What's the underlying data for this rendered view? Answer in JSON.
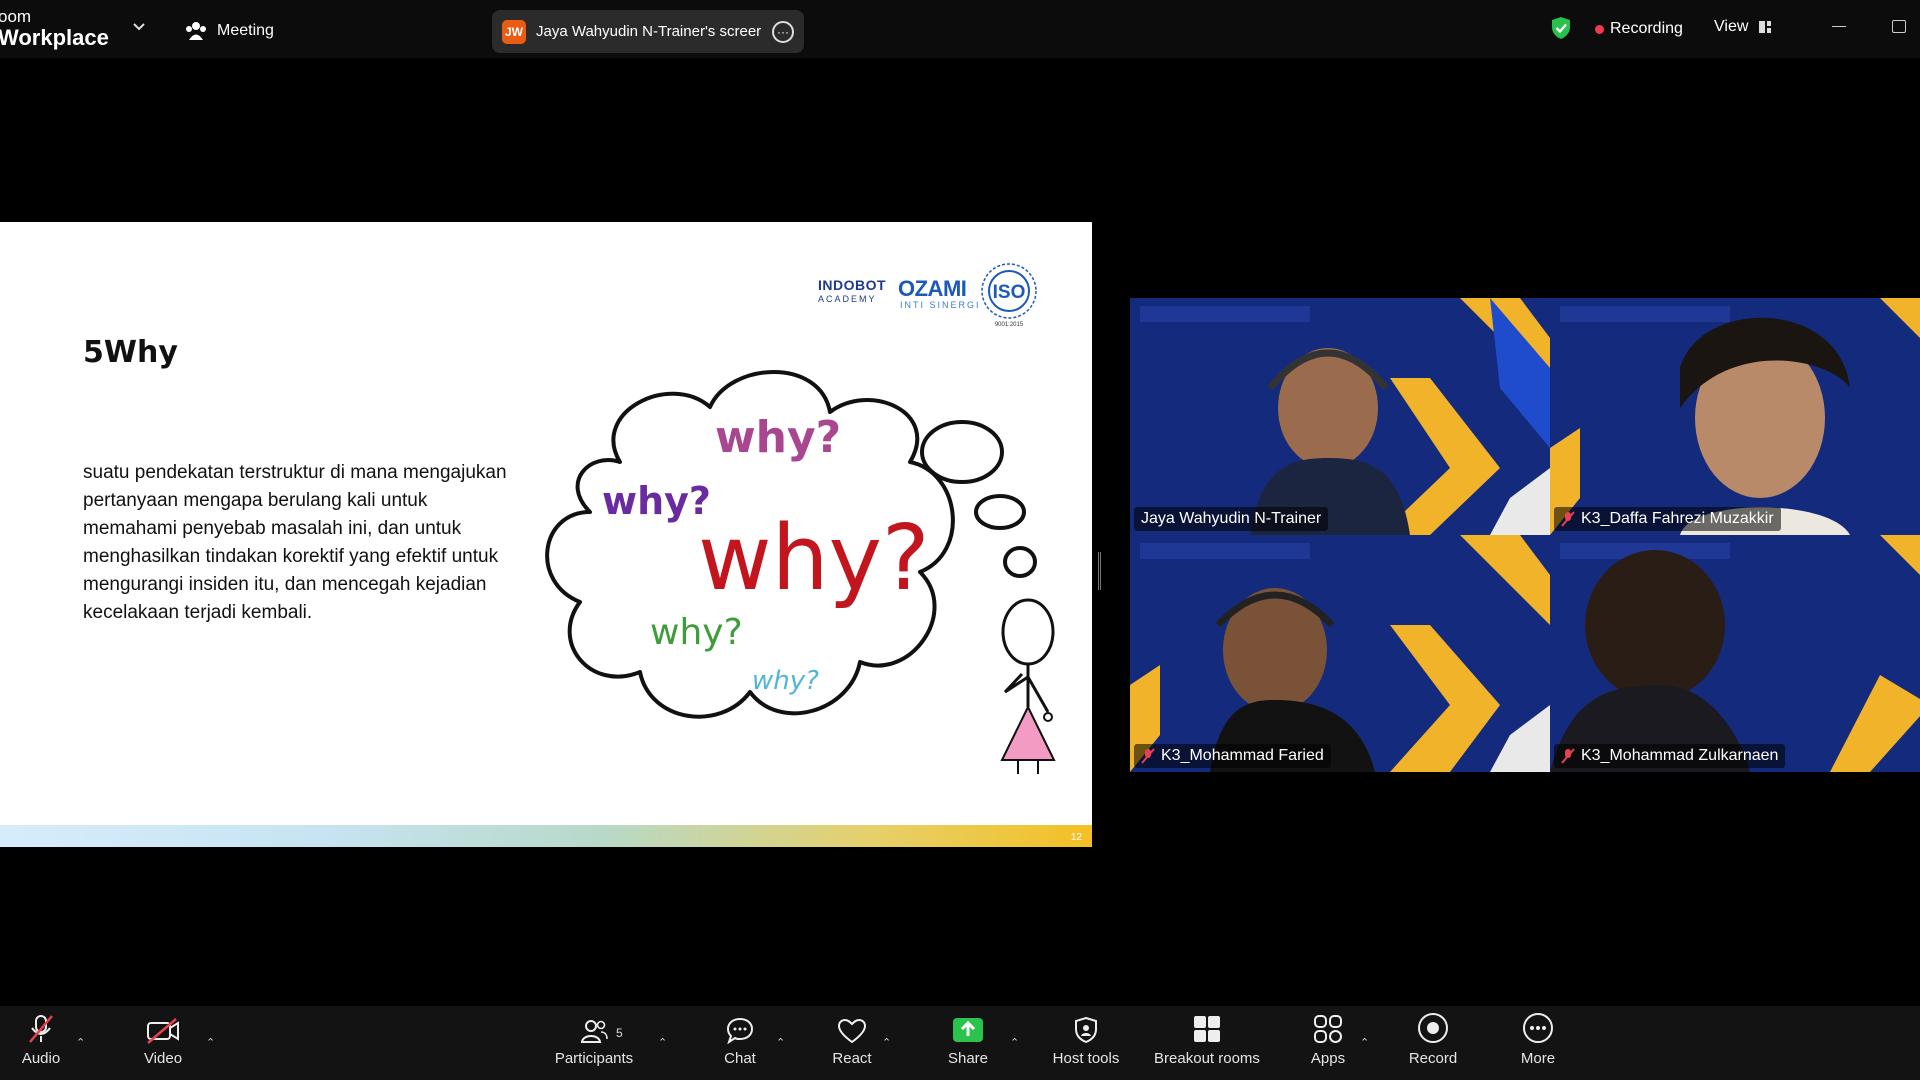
{
  "topbar": {
    "brand_line1": "oom",
    "brand_line2": "Workplace",
    "meeting_label": "Meeting",
    "sharer_initials": "JW",
    "sharer_label": "Jaya Wahyudin N-Trainer's screer",
    "recording_label": "Recording",
    "view_label": "View"
  },
  "slide": {
    "title": "5Why",
    "body": "suatu pendekatan terstruktur di mana mengajukan pertanyaan mengapa berulang kali untuk memahami penyebab masalah ini, dan untuk menghasilkan tindakan korektif yang efektif untuk mengurangi insiden itu, dan mencegah kejadian kecelakaan terjadi kembali.",
    "logo_indobot": "INDOBOT",
    "logo_academy": "ACADEMY",
    "logo_ozami": "OZAMI",
    "logo_inti": "INTI SINERGI",
    "logo_iso": "ISO",
    "logo_iso_code": "9001:2015",
    "page_number": "12",
    "words": {
      "w1": "why?",
      "w2": "why?",
      "w3": "why?",
      "w4": "why?",
      "w5": "why?"
    },
    "word_colors": {
      "w1": "#a8478f",
      "w2": "#6a2aa0",
      "w3": "#c2151e",
      "w4": "#3f9c3a",
      "w5": "#4fb6d6"
    }
  },
  "participants": [
    {
      "name": "Jaya Wahyudin N-Trainer",
      "muted": false,
      "active": true
    },
    {
      "name": "K3_Daffa Fahrezi Muzakkir",
      "muted": true,
      "active": false
    },
    {
      "name": "K3_Mohammad Faried",
      "muted": true,
      "active": false
    },
    {
      "name": "K3_Mohammad Zulkarnaen",
      "muted": true,
      "active": false
    }
  ],
  "toolbar": {
    "audio": "Audio",
    "video": "Video",
    "participants": "Participants",
    "participants_count": "5",
    "chat": "Chat",
    "react": "React",
    "share": "Share",
    "host_tools": "Host tools",
    "breakout_rooms": "Breakout rooms",
    "apps": "Apps",
    "record": "Record",
    "more": "More"
  },
  "colors": {
    "active_speaker": "#2ee6a1",
    "share_green": "#2bc24e",
    "recording_red": "#f23b4d",
    "shield_green": "#27c24c"
  }
}
